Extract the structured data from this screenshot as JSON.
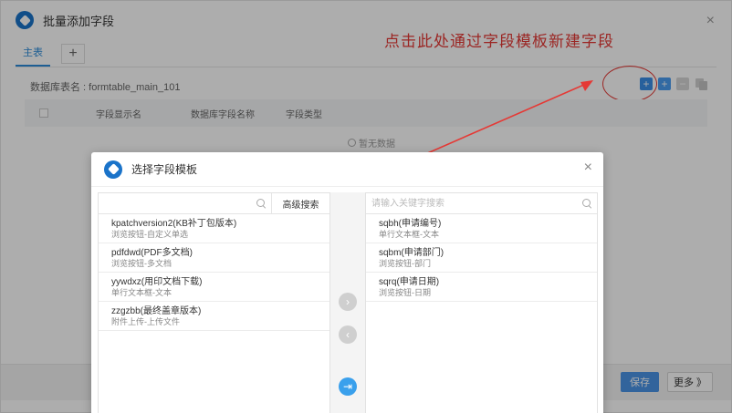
{
  "window": {
    "title": "批量添加字段",
    "close_glyph": "×"
  },
  "tabs": [
    {
      "label": "主表"
    }
  ],
  "tab_add_glyph": "+",
  "db_table_label": "数据库表名 : formtable_main_101",
  "toolbar": {
    "add_template_icon": "+",
    "add_icon": "+",
    "delete_icon": "−"
  },
  "grid": {
    "columns": [
      "字段显示名",
      "数据库字段名称",
      "字段类型"
    ],
    "empty_text": "暂无数据"
  },
  "annotation": "点击此处通过字段模板新建字段",
  "footer": {
    "save_label": "保存",
    "more_label": "更多 》"
  },
  "modal": {
    "title": "选择字段模板",
    "close_glyph": "×",
    "left": {
      "search_placeholder": "",
      "advanced_search_label": "高级搜索",
      "items": [
        {
          "name": "kpatchversion2(KB补丁包版本)",
          "desc": "浏览按钮-自定义单选"
        },
        {
          "name": "pdfdwd(PDF多文档)",
          "desc": "浏览按钮-多文档"
        },
        {
          "name": "yywdxz(用印文档下载)",
          "desc": "单行文本框-文本"
        },
        {
          "name": "zzgzbb(最终盖章版本)",
          "desc": "附件上传-上传文件"
        }
      ]
    },
    "right": {
      "search_placeholder": "请输入关键字搜索",
      "items": [
        {
          "name": "sqbh(申请编号)",
          "desc": "单行文本框-文本"
        },
        {
          "name": "sqbm(申请部门)",
          "desc": "浏览按钮-部门"
        },
        {
          "name": "sqrq(申请日期)",
          "desc": "浏览按钮-日期"
        }
      ]
    },
    "transfer": {
      "move_right_icon": "›",
      "move_left_icon": "‹",
      "move_all_icon": "⇥"
    }
  },
  "colors": {
    "accent": "#2b8bd9",
    "annotation": "#e53935",
    "save_button": "#4a94e6"
  }
}
